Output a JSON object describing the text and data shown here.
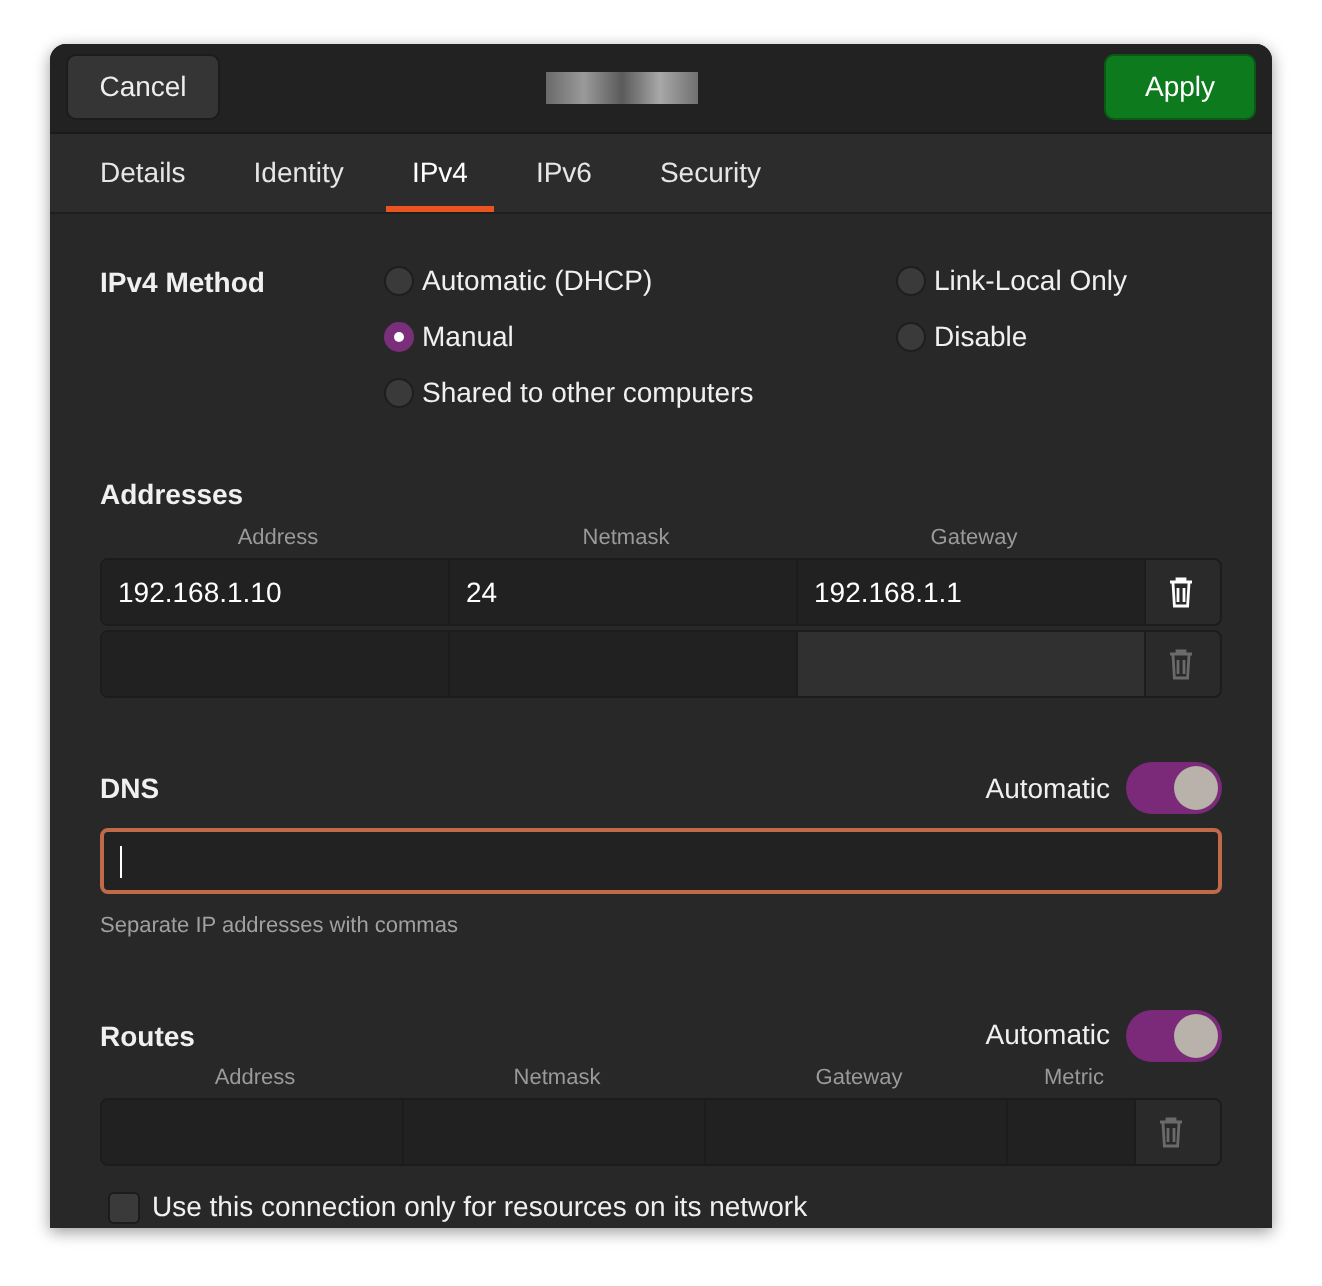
{
  "header": {
    "cancel": "Cancel",
    "apply": "Apply"
  },
  "tabs": [
    {
      "label": "Details",
      "selected": false
    },
    {
      "label": "Identity",
      "selected": false
    },
    {
      "label": "IPv4",
      "selected": true
    },
    {
      "label": "IPv6",
      "selected": false
    },
    {
      "label": "Security",
      "selected": false
    }
  ],
  "method": {
    "label": "IPv4 Method",
    "options": [
      {
        "label": "Automatic (DHCP)",
        "selected": false
      },
      {
        "label": "Link-Local Only",
        "selected": false
      },
      {
        "label": "Manual",
        "selected": true
      },
      {
        "label": "Disable",
        "selected": false
      },
      {
        "label": "Shared to other computers",
        "selected": false
      }
    ]
  },
  "addresses": {
    "title": "Addresses",
    "columns": [
      "Address",
      "Netmask",
      "Gateway"
    ],
    "rows": [
      {
        "cells": [
          "192.168.1.10",
          "24",
          "192.168.1.1"
        ],
        "gateway_disabled": false,
        "delete_disabled": false
      },
      {
        "cells": [
          "",
          "",
          ""
        ],
        "gateway_disabled": true,
        "delete_disabled": true
      }
    ]
  },
  "dns": {
    "title": "DNS",
    "toggle_label": "Automatic",
    "on": true,
    "focused": true,
    "hint": "Separate IP addresses with commas"
  },
  "routes": {
    "title": "Routes",
    "toggle_label": "Automatic",
    "on": true,
    "columns": [
      "Address",
      "Netmask",
      "Gateway",
      "Metric"
    ],
    "delete_disabled": true
  },
  "only_local": {
    "label": "Use this connection only for resources on its network",
    "checked": false
  }
}
